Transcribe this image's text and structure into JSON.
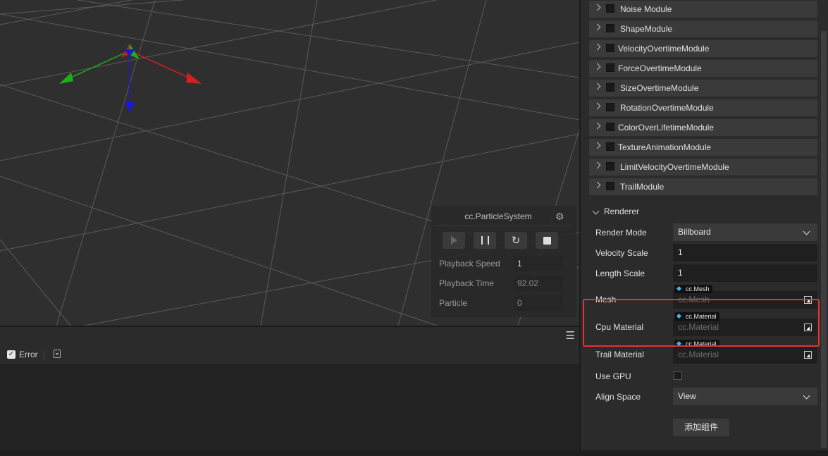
{
  "particle_panel": {
    "title": "cc.ParticleSystem",
    "rows": [
      {
        "label": "Playback Speed",
        "value": "1"
      },
      {
        "label": "Playback Time",
        "value": "92.02"
      },
      {
        "label": "Particle",
        "value": "0"
      }
    ]
  },
  "console": {
    "filter_label": "Error"
  },
  "modules": [
    {
      "label": "Noise Module"
    },
    {
      "label": "ShapeModule"
    },
    {
      "label": "VelocityOvertimeModule"
    },
    {
      "label": "ForceOvertimeModule"
    },
    {
      "label": "SizeOvertimeModule"
    },
    {
      "label": "RotationOvertimeModule"
    },
    {
      "label": "ColorOverLifetimeModule"
    },
    {
      "label": "TextureAnimationModule"
    },
    {
      "label": "LimitVelocityOvertimeModule"
    },
    {
      "label": "TrailModule"
    }
  ],
  "renderer": {
    "title": "Renderer",
    "render_mode": {
      "label": "Render Mode",
      "value": "Billboard"
    },
    "velocity_scale": {
      "label": "Velocity Scale",
      "value": "1"
    },
    "length_scale": {
      "label": "Length Scale",
      "value": "1"
    },
    "mesh": {
      "label": "Mesh",
      "type": "cc.Mesh",
      "placeholder": "cc.Mesh"
    },
    "cpu_material": {
      "label": "Cpu Material",
      "type": "cc.Material",
      "placeholder": "cc.Material"
    },
    "trail_material": {
      "label": "Trail Material",
      "type": "cc.Material",
      "placeholder": "cc.Material"
    },
    "use_gpu": {
      "label": "Use GPU",
      "checked": false
    },
    "align_space": {
      "label": "Align Space",
      "value": "View"
    }
  },
  "add_component_label": "添加组件",
  "colors": {
    "highlight": "#e5342a",
    "axis_x": "#d42020",
    "axis_y": "#19b019",
    "axis_z": "#1a1ad0",
    "asset_diamond": "#46b4e6"
  }
}
